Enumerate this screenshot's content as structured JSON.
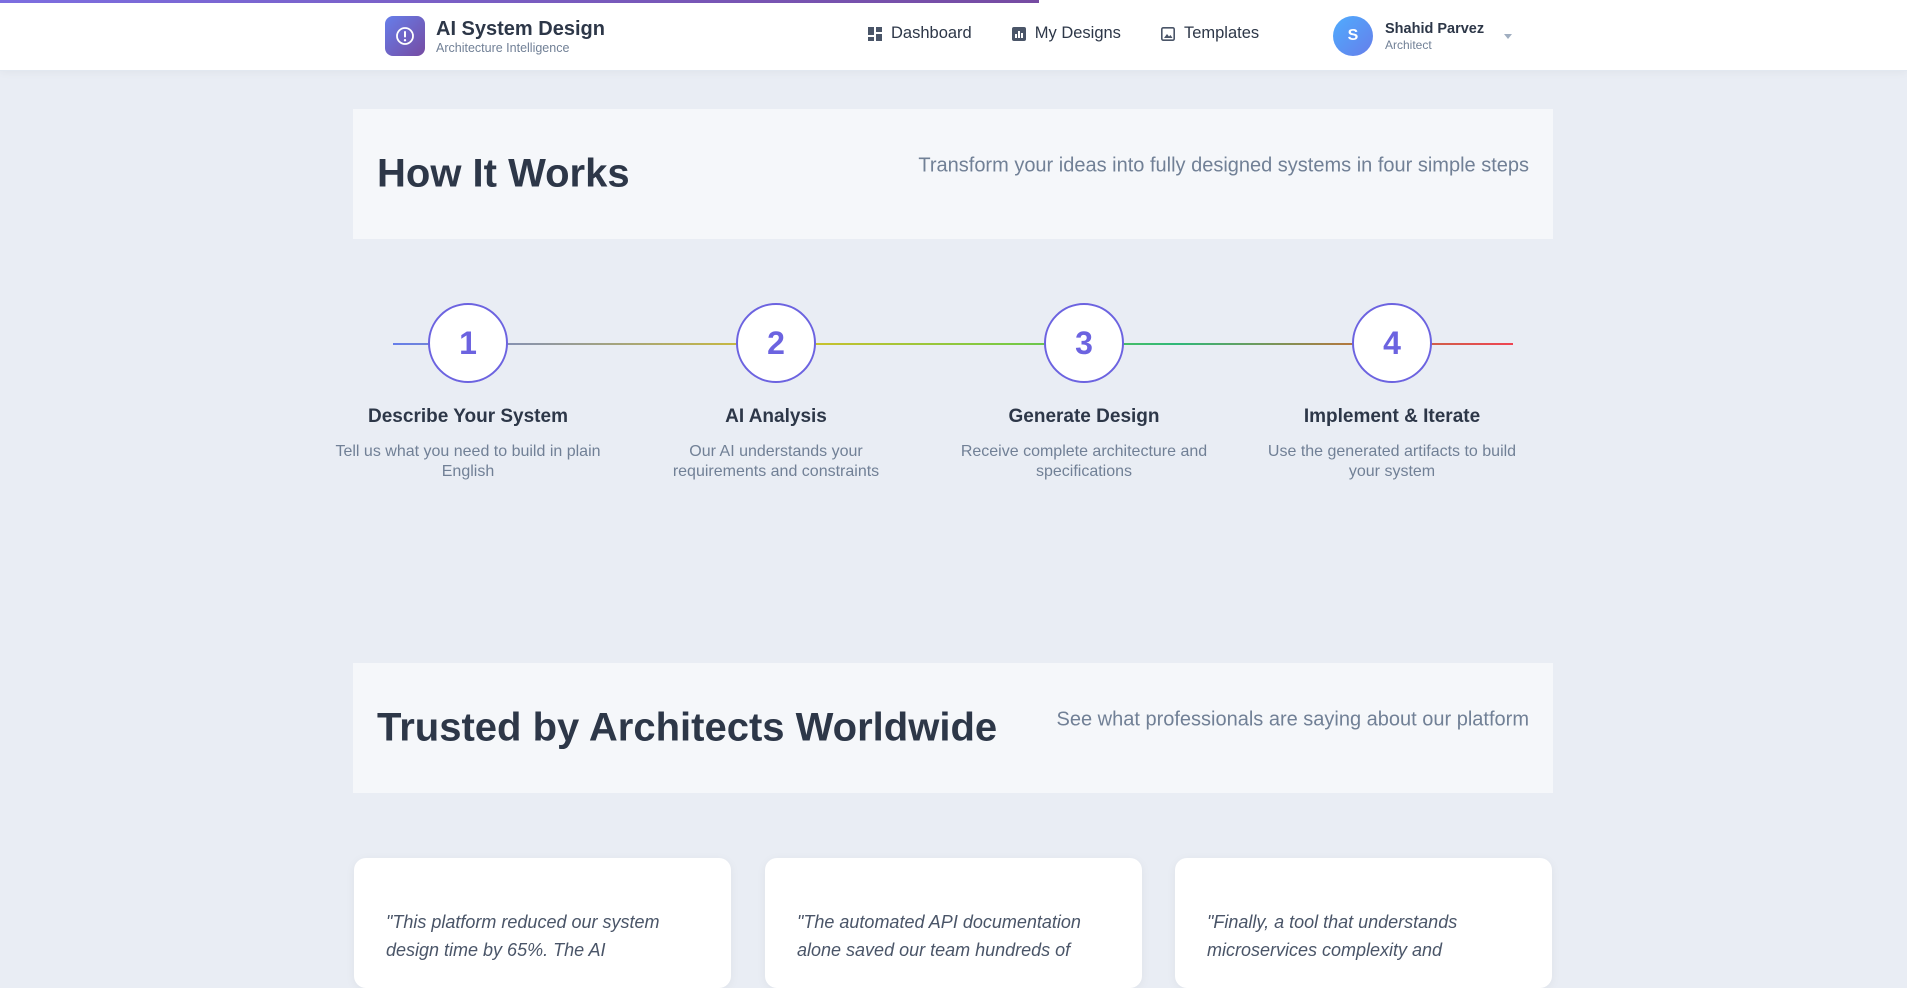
{
  "nav": {
    "brand_title": "AI System Design",
    "brand_subtitle": "Architecture Intelligence",
    "links": [
      {
        "label": "Dashboard",
        "icon": "dashboard-icon"
      },
      {
        "label": "My Designs",
        "icon": "chart-icon"
      },
      {
        "label": "Templates",
        "icon": "image-icon"
      }
    ],
    "user": {
      "initial": "S",
      "name": "Shahid Parvez",
      "role": "Architect"
    }
  },
  "how_it_works": {
    "title": "How It Works",
    "subtitle": "Transform your ideas into fully designed systems in four simple steps",
    "steps": [
      {
        "number": "1",
        "title": "Describe Your System",
        "description": "Tell us what you need to build in plain English"
      },
      {
        "number": "2",
        "title": "AI Analysis",
        "description": "Our AI understands your requirements and constraints"
      },
      {
        "number": "3",
        "title": "Generate Design",
        "description": "Receive complete architecture and specifications"
      },
      {
        "number": "4",
        "title": "Implement & Iterate",
        "description": "Use the generated artifacts to build your system"
      }
    ]
  },
  "testimonials": {
    "title": "Trusted by Architects Worldwide",
    "subtitle": "See what professionals are saying about our platform",
    "quotes": [
      "\"This platform reduced our system design time by 65%. The AI",
      "\"The automated API documentation alone saved our team hundreds of",
      "\"Finally, a tool that understands microservices complexity and"
    ]
  },
  "colors": {
    "accent": "#6c63e0",
    "brand_gradient_start": "#667eea",
    "brand_gradient_end": "#764ba2",
    "background": "#e9edf4"
  }
}
